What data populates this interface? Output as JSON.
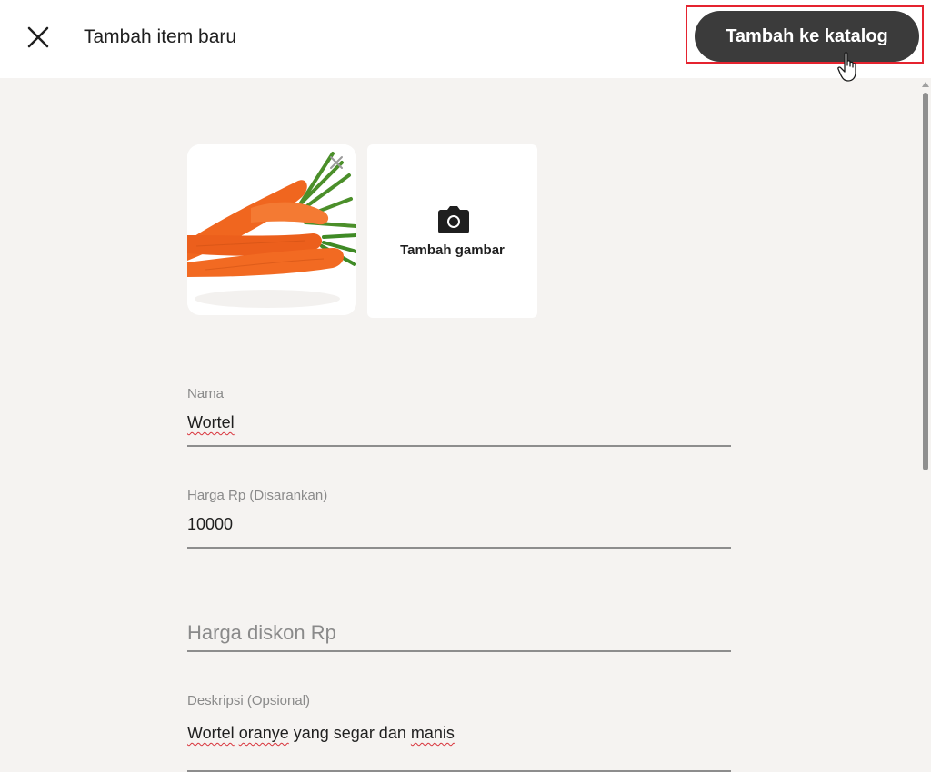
{
  "header": {
    "title": "Tambah item baru",
    "primary_button_label": "Tambah ke katalog"
  },
  "images": {
    "items": [
      {
        "alt": "Wortel"
      }
    ],
    "add_label": "Tambah gambar"
  },
  "form": {
    "name": {
      "label": "Nama",
      "value": "Wortel"
    },
    "price": {
      "label": "Harga Rp (Disarankan)",
      "value": "10000"
    },
    "discount": {
      "placeholder": "Harga diskon Rp",
      "value": ""
    },
    "description": {
      "label": "Deskripsi (Opsional)",
      "value_parts": [
        "Wortel",
        " ",
        "oranye",
        " yang segar dan ",
        "manis"
      ]
    }
  },
  "colors": {
    "primary_button": "#3b3b3b",
    "highlight": "#e5232f",
    "background": "#f5f3f1",
    "carrot": "#f0661f"
  },
  "icons": {
    "close": "close-icon",
    "camera": "camera-icon",
    "remove": "remove-image-icon",
    "cursor": "pointer-hand-icon"
  }
}
